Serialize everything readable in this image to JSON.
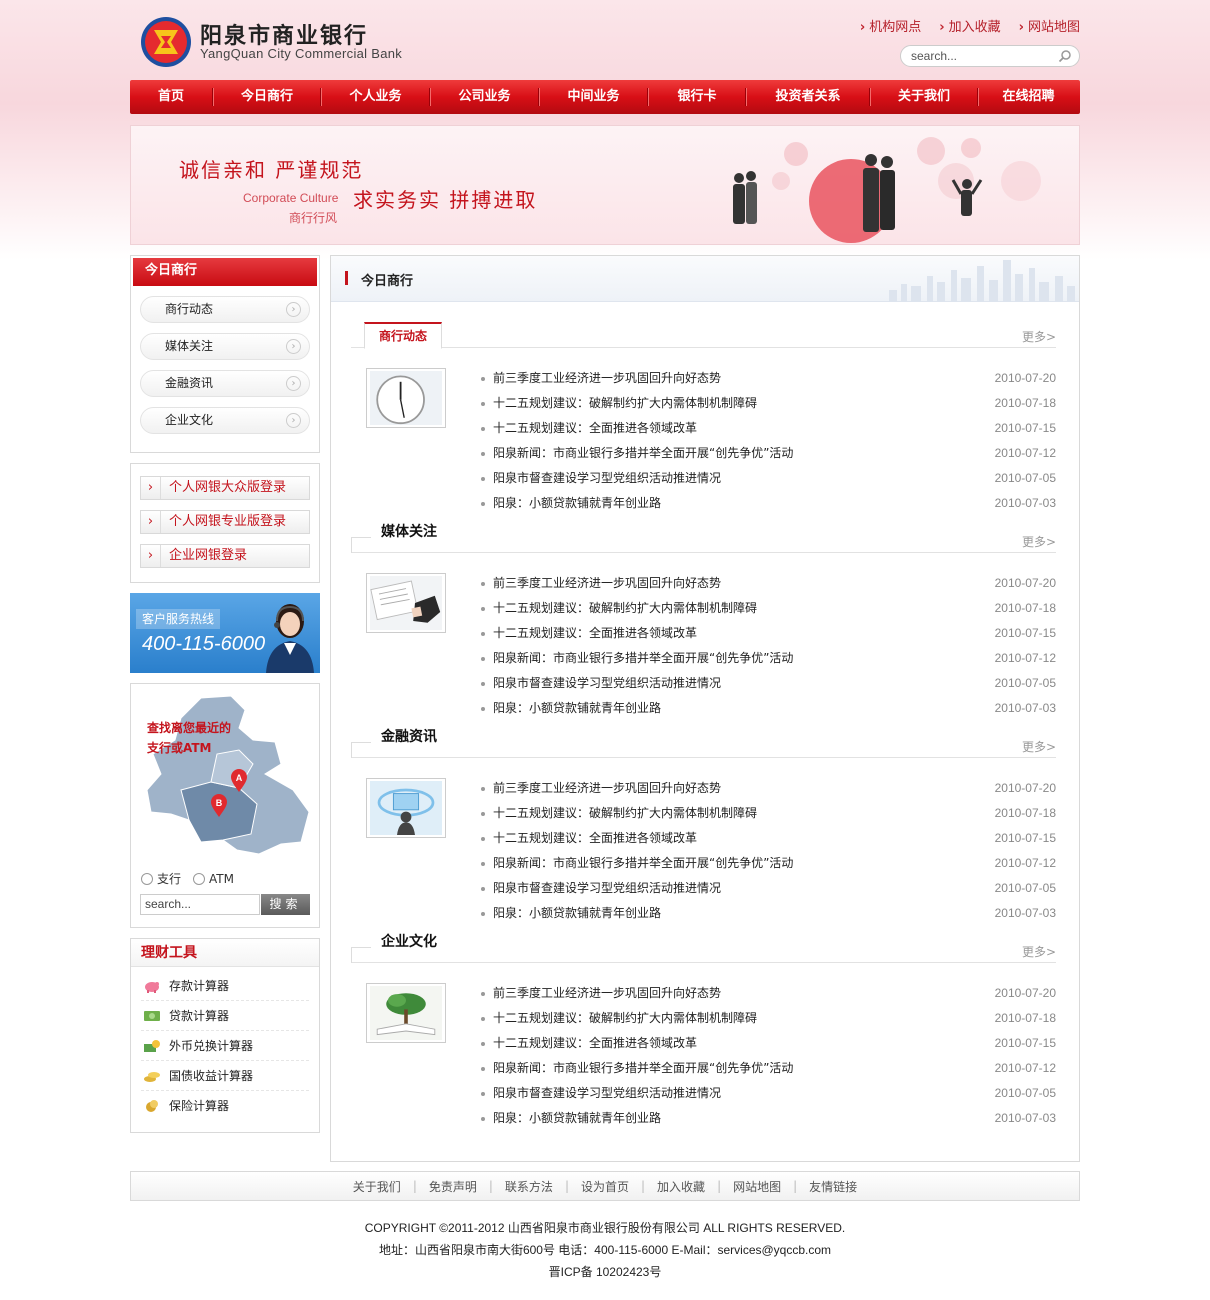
{
  "header": {
    "bank_name_cn": "阳泉市商业银行",
    "bank_name_en": "YangQuan City Commercial Bank",
    "top_links": [
      "机构网点",
      "加入收藏",
      "网站地图"
    ],
    "search_placeholder": "search..."
  },
  "nav": {
    "items": [
      "首页",
      "今日商行",
      "个人业务",
      "公司业务",
      "中间业务",
      "银行卡",
      "投资者关系",
      "关于我们",
      "在线招聘"
    ]
  },
  "banner": {
    "slogan_line1": "诚信亲和  严谨规范",
    "slogan_line2": "求实务实  拼搏进取",
    "caption_en": "Corporate Culture",
    "caption_cn": "商行行风"
  },
  "sidebar": {
    "today_title": "今日商行",
    "today_items": [
      "商行动态",
      "媒体关注",
      "金融资讯",
      "企业文化"
    ],
    "login_buttons": [
      "个人网银大众版登录",
      "个人网银专业版登录",
      "企业网银登录"
    ],
    "hotline_label": "客户服务热线",
    "hotline_number": "400-115-6000",
    "map_title_line1": "查找离您最近的",
    "map_title_line2": "支行或ATM",
    "map_marker_a": "A",
    "map_marker_b": "B",
    "radio_branch": "支行",
    "radio_atm": "ATM",
    "map_search_placeholder": "search...",
    "map_search_button": "搜索",
    "tools_title": "理财工具",
    "tools": [
      "存款计算器",
      "贷款计算器",
      "外币兑换计算器",
      "国债收益计算器",
      "保险计算器"
    ]
  },
  "main": {
    "title": "今日商行",
    "more_label": "更多>",
    "sections": [
      {
        "title": "商行动态",
        "news": [
          {
            "title": "前三季度工业经济进一步巩固回升向好态势",
            "date": "2010-07-20"
          },
          {
            "title": "十二五规划建议：破解制约扩大内需体制机制障碍",
            "date": "2010-07-18"
          },
          {
            "title": "十二五规划建议：全面推进各领域改革",
            "date": "2010-07-15"
          },
          {
            "title": "阳泉新闻：市商业银行多措并举全面开展“创先争优”活动",
            "date": "2010-07-12"
          },
          {
            "title": "阳泉市督查建设学习型党组织活动推进情况",
            "date": "2010-07-05"
          },
          {
            "title": "阳泉：小额贷款铺就青年创业路",
            "date": "2010-07-03"
          }
        ]
      },
      {
        "title": "媒体关注",
        "news": [
          {
            "title": "前三季度工业经济进一步巩固回升向好态势",
            "date": "2010-07-20"
          },
          {
            "title": "十二五规划建议：破解制约扩大内需体制机制障碍",
            "date": "2010-07-18"
          },
          {
            "title": "十二五规划建议：全面推进各领域改革",
            "date": "2010-07-15"
          },
          {
            "title": "阳泉新闻：市商业银行多措并举全面开展“创先争优”活动",
            "date": "2010-07-12"
          },
          {
            "title": "阳泉市督查建设学习型党组织活动推进情况",
            "date": "2010-07-05"
          },
          {
            "title": "阳泉：小额贷款铺就青年创业路",
            "date": "2010-07-03"
          }
        ]
      },
      {
        "title": "金融资讯",
        "news": [
          {
            "title": "前三季度工业经济进一步巩固回升向好态势",
            "date": "2010-07-20"
          },
          {
            "title": "十二五规划建议：破解制约扩大内需体制机制障碍",
            "date": "2010-07-18"
          },
          {
            "title": "十二五规划建议：全面推进各领域改革",
            "date": "2010-07-15"
          },
          {
            "title": "阳泉新闻：市商业银行多措并举全面开展“创先争优”活动",
            "date": "2010-07-12"
          },
          {
            "title": "阳泉市督查建设学习型党组织活动推进情况",
            "date": "2010-07-05"
          },
          {
            "title": "阳泉：小额贷款铺就青年创业路",
            "date": "2010-07-03"
          }
        ]
      },
      {
        "title": "企业文化",
        "news": [
          {
            "title": "前三季度工业经济进一步巩固回升向好态势",
            "date": "2010-07-20"
          },
          {
            "title": "十二五规划建议：破解制约扩大内需体制机制障碍",
            "date": "2010-07-18"
          },
          {
            "title": "十二五规划建议：全面推进各领域改革",
            "date": "2010-07-15"
          },
          {
            "title": "阳泉新闻：市商业银行多措并举全面开展“创先争优”活动",
            "date": "2010-07-12"
          },
          {
            "title": "阳泉市督查建设学习型党组织活动推进情况",
            "date": "2010-07-05"
          },
          {
            "title": "阳泉：小额贷款铺就青年创业路",
            "date": "2010-07-03"
          }
        ]
      }
    ]
  },
  "footer": {
    "links": [
      "关于我们",
      "免责声明",
      "联系方法",
      "设为首页",
      "加入收藏",
      "网站地图",
      "友情链接"
    ],
    "copyright": "COPYRIGHT ©2011-2012   山西省阳泉市商业银行股份有限公司    ALL RIGHTS RESERVED.",
    "address": "地址：山西省阳泉市南大街600号   电话：400-115-6000   E-Mail：services@yqccb.com",
    "icp": "晋ICP备 10202423号"
  },
  "colors": {
    "brand_red": "#c4141d",
    "nav_red": "#d80f16",
    "hotline_blue": "#2a7fcc"
  }
}
